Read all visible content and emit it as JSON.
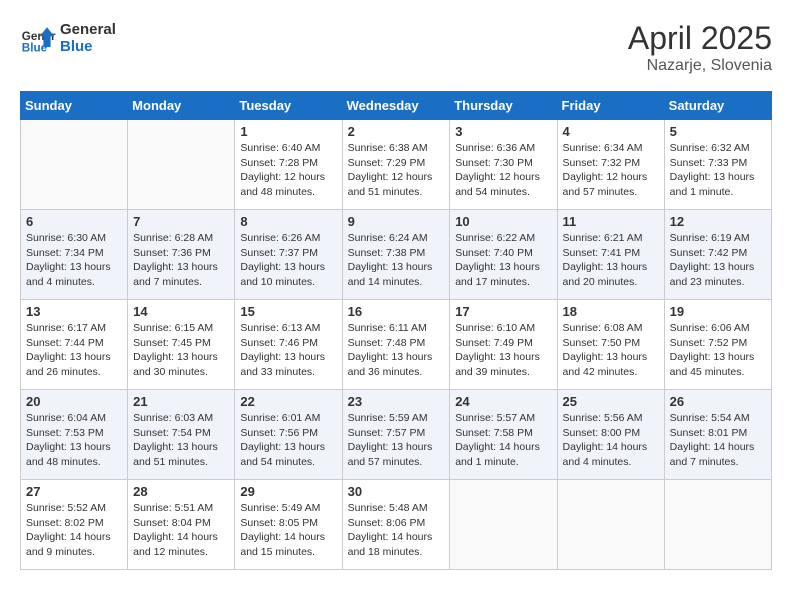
{
  "logo": {
    "line1": "General",
    "line2": "Blue"
  },
  "title": "April 2025",
  "location": "Nazarje, Slovenia",
  "weekdays": [
    "Sunday",
    "Monday",
    "Tuesday",
    "Wednesday",
    "Thursday",
    "Friday",
    "Saturday"
  ],
  "weeks": [
    [
      {
        "day": "",
        "info": ""
      },
      {
        "day": "",
        "info": ""
      },
      {
        "day": "1",
        "info": "Sunrise: 6:40 AM\nSunset: 7:28 PM\nDaylight: 12 hours and 48 minutes."
      },
      {
        "day": "2",
        "info": "Sunrise: 6:38 AM\nSunset: 7:29 PM\nDaylight: 12 hours and 51 minutes."
      },
      {
        "day": "3",
        "info": "Sunrise: 6:36 AM\nSunset: 7:30 PM\nDaylight: 12 hours and 54 minutes."
      },
      {
        "day": "4",
        "info": "Sunrise: 6:34 AM\nSunset: 7:32 PM\nDaylight: 12 hours and 57 minutes."
      },
      {
        "day": "5",
        "info": "Sunrise: 6:32 AM\nSunset: 7:33 PM\nDaylight: 13 hours and 1 minute."
      }
    ],
    [
      {
        "day": "6",
        "info": "Sunrise: 6:30 AM\nSunset: 7:34 PM\nDaylight: 13 hours and 4 minutes."
      },
      {
        "day": "7",
        "info": "Sunrise: 6:28 AM\nSunset: 7:36 PM\nDaylight: 13 hours and 7 minutes."
      },
      {
        "day": "8",
        "info": "Sunrise: 6:26 AM\nSunset: 7:37 PM\nDaylight: 13 hours and 10 minutes."
      },
      {
        "day": "9",
        "info": "Sunrise: 6:24 AM\nSunset: 7:38 PM\nDaylight: 13 hours and 14 minutes."
      },
      {
        "day": "10",
        "info": "Sunrise: 6:22 AM\nSunset: 7:40 PM\nDaylight: 13 hours and 17 minutes."
      },
      {
        "day": "11",
        "info": "Sunrise: 6:21 AM\nSunset: 7:41 PM\nDaylight: 13 hours and 20 minutes."
      },
      {
        "day": "12",
        "info": "Sunrise: 6:19 AM\nSunset: 7:42 PM\nDaylight: 13 hours and 23 minutes."
      }
    ],
    [
      {
        "day": "13",
        "info": "Sunrise: 6:17 AM\nSunset: 7:44 PM\nDaylight: 13 hours and 26 minutes."
      },
      {
        "day": "14",
        "info": "Sunrise: 6:15 AM\nSunset: 7:45 PM\nDaylight: 13 hours and 30 minutes."
      },
      {
        "day": "15",
        "info": "Sunrise: 6:13 AM\nSunset: 7:46 PM\nDaylight: 13 hours and 33 minutes."
      },
      {
        "day": "16",
        "info": "Sunrise: 6:11 AM\nSunset: 7:48 PM\nDaylight: 13 hours and 36 minutes."
      },
      {
        "day": "17",
        "info": "Sunrise: 6:10 AM\nSunset: 7:49 PM\nDaylight: 13 hours and 39 minutes."
      },
      {
        "day": "18",
        "info": "Sunrise: 6:08 AM\nSunset: 7:50 PM\nDaylight: 13 hours and 42 minutes."
      },
      {
        "day": "19",
        "info": "Sunrise: 6:06 AM\nSunset: 7:52 PM\nDaylight: 13 hours and 45 minutes."
      }
    ],
    [
      {
        "day": "20",
        "info": "Sunrise: 6:04 AM\nSunset: 7:53 PM\nDaylight: 13 hours and 48 minutes."
      },
      {
        "day": "21",
        "info": "Sunrise: 6:03 AM\nSunset: 7:54 PM\nDaylight: 13 hours and 51 minutes."
      },
      {
        "day": "22",
        "info": "Sunrise: 6:01 AM\nSunset: 7:56 PM\nDaylight: 13 hours and 54 minutes."
      },
      {
        "day": "23",
        "info": "Sunrise: 5:59 AM\nSunset: 7:57 PM\nDaylight: 13 hours and 57 minutes."
      },
      {
        "day": "24",
        "info": "Sunrise: 5:57 AM\nSunset: 7:58 PM\nDaylight: 14 hours and 1 minute."
      },
      {
        "day": "25",
        "info": "Sunrise: 5:56 AM\nSunset: 8:00 PM\nDaylight: 14 hours and 4 minutes."
      },
      {
        "day": "26",
        "info": "Sunrise: 5:54 AM\nSunset: 8:01 PM\nDaylight: 14 hours and 7 minutes."
      }
    ],
    [
      {
        "day": "27",
        "info": "Sunrise: 5:52 AM\nSunset: 8:02 PM\nDaylight: 14 hours and 9 minutes."
      },
      {
        "day": "28",
        "info": "Sunrise: 5:51 AM\nSunset: 8:04 PM\nDaylight: 14 hours and 12 minutes."
      },
      {
        "day": "29",
        "info": "Sunrise: 5:49 AM\nSunset: 8:05 PM\nDaylight: 14 hours and 15 minutes."
      },
      {
        "day": "30",
        "info": "Sunrise: 5:48 AM\nSunset: 8:06 PM\nDaylight: 14 hours and 18 minutes."
      },
      {
        "day": "",
        "info": ""
      },
      {
        "day": "",
        "info": ""
      },
      {
        "day": "",
        "info": ""
      }
    ]
  ]
}
